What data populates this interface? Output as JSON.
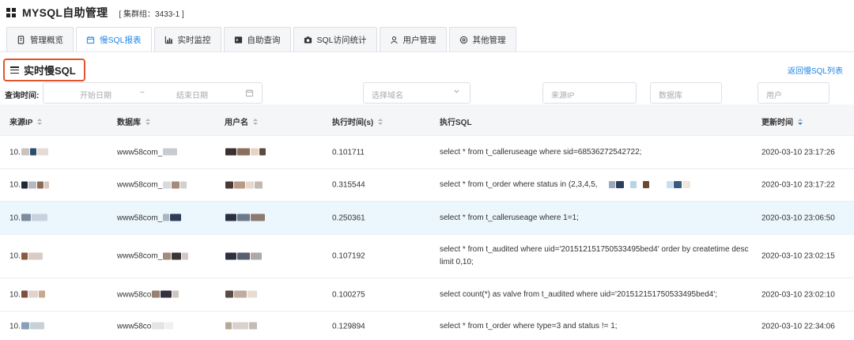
{
  "header": {
    "app_title": "MYSQL自助管理",
    "cluster_label": "[ 集群组：3433-1 ]"
  },
  "tabs": [
    {
      "label": "管理概览",
      "icon": "document-icon",
      "active": false
    },
    {
      "label": "慢SQL报表",
      "icon": "calendar-icon",
      "active": true
    },
    {
      "label": "实时监控",
      "icon": "chart-icon",
      "active": false
    },
    {
      "label": "自助查询",
      "icon": "terminal-icon",
      "active": false
    },
    {
      "label": "SQL访问统计",
      "icon": "camera-icon",
      "active": false
    },
    {
      "label": "用户管理",
      "icon": "user-icon",
      "active": false
    },
    {
      "label": "其他管理",
      "icon": "settings-icon",
      "active": false
    }
  ],
  "section": {
    "title": "实时慢SQL",
    "back_link": "返回慢SQL列表"
  },
  "filters": {
    "query_time_label": "查询时间:",
    "start_placeholder": "开始日期",
    "separator": "~",
    "end_placeholder": "结束日期",
    "domain_placeholder": "选择域名",
    "source_ip_placeholder": "来源IP",
    "database_placeholder": "数据库",
    "user_placeholder": "用户"
  },
  "table": {
    "columns": [
      "来源IP",
      "数据库",
      "用户名",
      "执行时间(s)",
      "执行SQL",
      "更新时间"
    ],
    "sorted_column": "更新时间",
    "sort_direction": "descending",
    "rows": [
      {
        "ip": "10.",
        "db": "www58com_",
        "user": "",
        "time": "0.101711",
        "sql": "select * from t_calleruseage where sid=68536272542722;",
        "updated": "2020-03-10 23:17:26",
        "highlight": false
      },
      {
        "ip": "10.",
        "db": "www58com_",
        "user": "",
        "time": "0.315544",
        "sql": "select * from t_order where status in (2,3,4,5,",
        "updated": "2020-03-10 23:17:22",
        "highlight": false
      },
      {
        "ip": "10.",
        "db": "www58com_",
        "user": "",
        "time": "0.250361",
        "sql": "select * from t_calleruseage where 1=1;",
        "updated": "2020-03-10 23:06:50",
        "highlight": true
      },
      {
        "ip": "10.",
        "db": "www58com_",
        "user": "",
        "time": "0.107192",
        "sql": "select * from t_audited where uid='201512151750533495bed4' order by createtime desc limit 0,10;",
        "updated": "2020-03-10 23:02:15",
        "highlight": false
      },
      {
        "ip": "10.",
        "db": "www58co",
        "user": "",
        "time": "0.100275",
        "sql": "select count(*) as valve from t_audited where uid='201512151750533495bed4';",
        "updated": "2020-03-10 23:02:10",
        "highlight": false
      },
      {
        "ip": "10.",
        "db": "www58co",
        "user": "",
        "time": "0.129894",
        "sql": "select * from t_order where type=3 and status != 1;",
        "updated": "2020-03-10 22:34:06",
        "highlight": false
      }
    ]
  },
  "colors": {
    "accent": "#1e88e5",
    "highlight_border": "#e2552c",
    "selected_row": "#ecf6fd"
  }
}
